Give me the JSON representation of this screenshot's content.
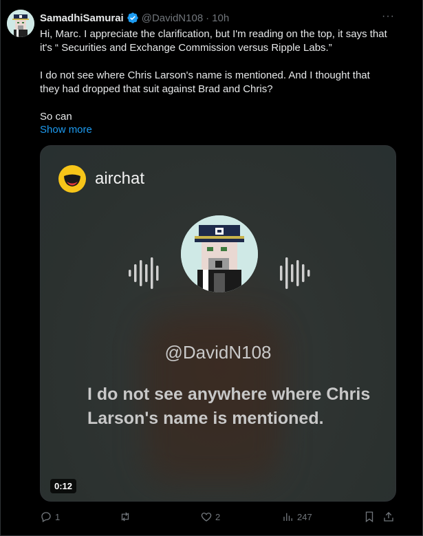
{
  "tweet": {
    "display_name": "SamadhiSamurai",
    "handle": "@DavidN108",
    "separator": "·",
    "time": "10h",
    "more_label": "···",
    "text": "Hi, Marc. I appreciate the clarification, but I'm reading on the top, it says that it's “ Securities and Exchange Commission versus Ripple Labs.”\n\nI do not see where Chris Larson's name is mentioned. And I thought that they had dropped that suit against Brad and Chris?\n\nSo can",
    "show_more": "Show more"
  },
  "media": {
    "brand_name": "airchat",
    "voice_handle": "@DavidN108",
    "caption": "I do not see anywhere where Chris Larson's name is mentioned.",
    "duration": "0:12"
  },
  "actions": {
    "replies": "1",
    "reposts": "",
    "likes": "2",
    "views": "247"
  },
  "colors": {
    "background": "#000000",
    "accent": "#1d9bf0",
    "muted": "#71767b",
    "brand_yellow": "#f7c519"
  },
  "icons": [
    "verified-icon",
    "more-icon",
    "reply-icon",
    "repost-icon",
    "like-icon",
    "views-icon",
    "bookmark-icon",
    "share-icon",
    "airchat-logo",
    "sound-wave-icon"
  ]
}
